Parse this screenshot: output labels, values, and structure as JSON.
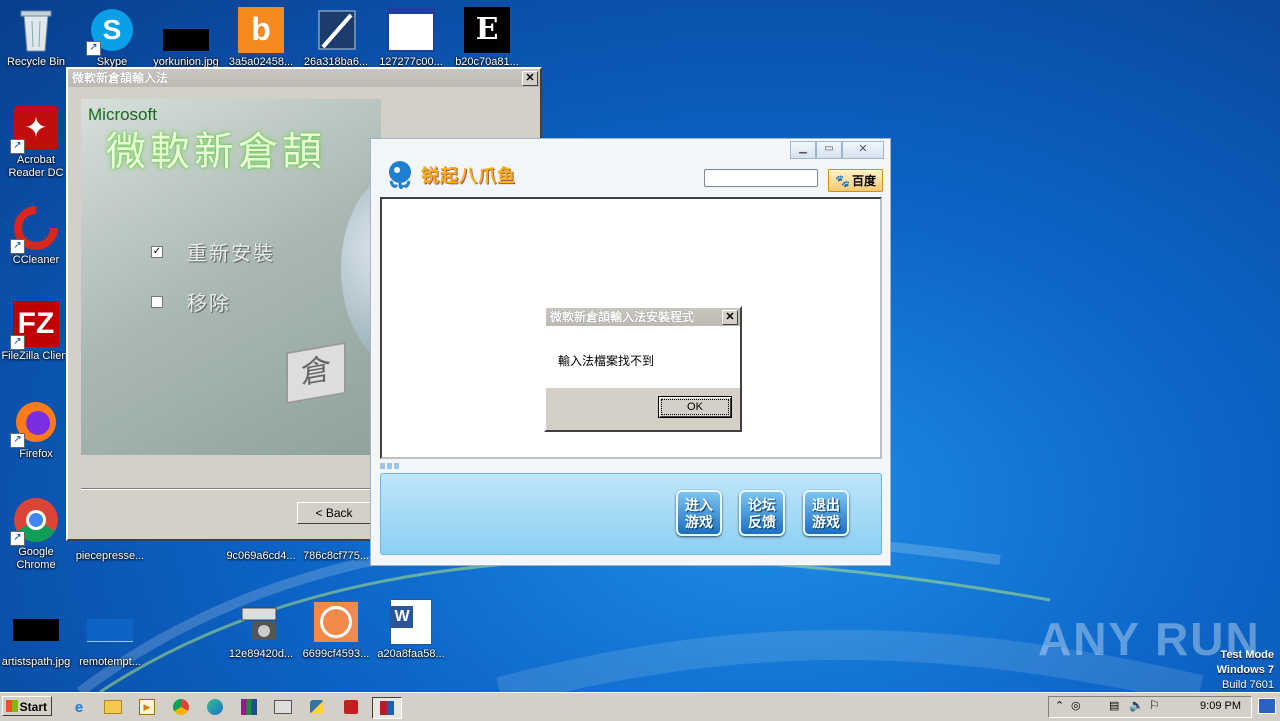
{
  "desktop": {
    "icons_left": [
      {
        "label": "Recycle Bin"
      },
      {
        "label": "Acrobat Reader DC"
      },
      {
        "label": "CCleaner"
      },
      {
        "label": "FileZilla Client"
      },
      {
        "label": "Firefox"
      },
      {
        "label": "Google Chrome"
      },
      {
        "label": "artistspath.jpg"
      }
    ],
    "icons_top": [
      {
        "label": "Skype"
      },
      {
        "label": "yorkunion.jpg"
      },
      {
        "label": "3a5a02458..."
      },
      {
        "label": "26a318ba6..."
      },
      {
        "label": "127277c00..."
      },
      {
        "label": "b20c70a81..."
      }
    ],
    "icons_mid": [
      {
        "label": "piecepresse..."
      },
      {
        "label": "9c069a6cd4..."
      },
      {
        "label": "786c8cf775..."
      }
    ],
    "icons_bottom": [
      {
        "label": "remotempt..."
      },
      {
        "label": "12e89420d..."
      },
      {
        "label": "6699cf4593..."
      },
      {
        "label": "a20a8faa58..."
      }
    ],
    "watermark": "ANY RUN",
    "test_mode": [
      "Test Mode",
      "Windows 7",
      "Build 7601"
    ]
  },
  "installer": {
    "title": "微軟新倉頡輸入法",
    "brand": "Microsoft",
    "product": "微軟新倉頡",
    "options": [
      {
        "label": "重新安裝",
        "checked": true
      },
      {
        "label": "移除",
        "checked": false
      }
    ],
    "back_button": "< Back",
    "key_label": "倉"
  },
  "game": {
    "title": "锐起八爪鱼",
    "search_value": "",
    "search_button": "百度",
    "buttons": [
      {
        "label": "进入\n游戏"
      },
      {
        "label": "论坛\n反馈"
      },
      {
        "label": "退出\n游戏"
      }
    ]
  },
  "dialog": {
    "title": "微軟新倉頡輸入法安裝程式",
    "message": "輸入法檔案找不到",
    "ok": "OK"
  },
  "taskbar": {
    "start": "Start",
    "clock": "9:09 PM"
  },
  "colors": {
    "accent": "#0a5fc4",
    "game_panel": "#9fd6f3"
  }
}
